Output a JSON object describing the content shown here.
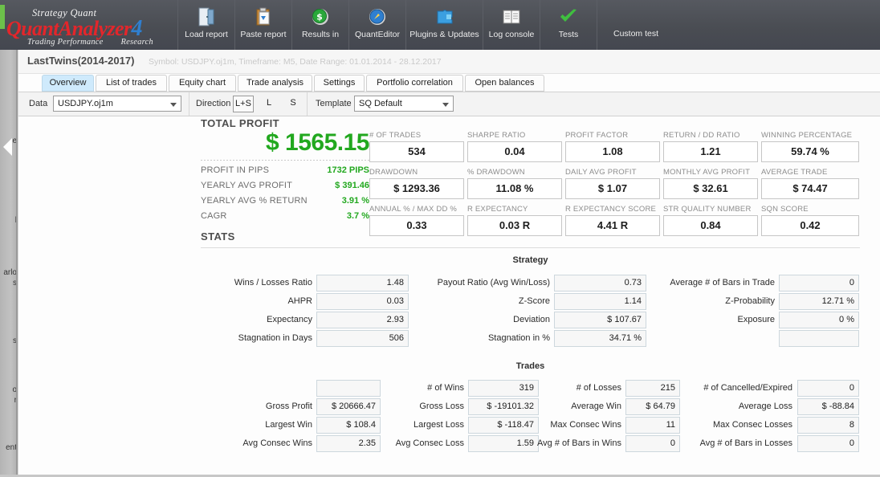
{
  "app": {
    "logo_top": "Strategy Quant",
    "logo_main": "QuantAnalyzer",
    "logo_version": "4",
    "logo_sub_1": "Trading Performance",
    "logo_sub_2": "Research"
  },
  "toolbar": {
    "buttons": [
      {
        "label": "Load report",
        "icon": "door-open-icon"
      },
      {
        "label": "Paste report",
        "icon": "clipboard-paste-icon"
      },
      {
        "label": "Results in",
        "icon": "dollar-coin-icon"
      },
      {
        "label": "QuantEditor",
        "icon": "globe-compass-icon"
      },
      {
        "label": "Plugins & Updates",
        "icon": "puzzle-piece-icon"
      },
      {
        "label": "Log console",
        "icon": "book-icon"
      },
      {
        "label": "Tests",
        "icon": "green-check-icon"
      },
      {
        "label": "Custom test",
        "icon": "none"
      }
    ]
  },
  "sidebar": {
    "fragments": [
      "e",
      "l",
      "arlo",
      "s",
      "s",
      "o",
      "r",
      "ent"
    ]
  },
  "header": {
    "title": "LastTwins(2014-2017)",
    "subtitle": "Symbol: USDJPY.oj1m, Timeframe: M5, Date Range: 01.01.2014 - 28.12.2017"
  },
  "tabs": [
    {
      "label": "Overview",
      "active": true
    },
    {
      "label": "List of trades",
      "active": false
    },
    {
      "label": "Equity chart",
      "active": false
    },
    {
      "label": "Trade analysis",
      "active": false
    },
    {
      "label": "Settings",
      "active": false
    },
    {
      "label": "Portfolio correlation",
      "active": false
    },
    {
      "label": "Open balances",
      "active": false
    }
  ],
  "filters": {
    "data_label": "Data",
    "data_value": "USDJPY.oj1m",
    "direction_label": "Direction",
    "direction_options": [
      "L+S",
      "L",
      "S"
    ],
    "direction_selected": "L+S",
    "template_label": "Template",
    "template_value": "SQ Default"
  },
  "total_profit": {
    "title": "TOTAL PROFIT",
    "value": "$ 1565.15",
    "rows": [
      {
        "key": "PROFIT IN PIPS",
        "value": "1732 PIPS"
      },
      {
        "key": "YEARLY AVG PROFIT",
        "value": "$ 391.46"
      },
      {
        "key": "YEARLY AVG % RETURN",
        "value": "3.91 %"
      },
      {
        "key": "CAGR",
        "value": "3.7 %"
      }
    ]
  },
  "kpis": [
    {
      "caption": "# OF TRADES",
      "value": "534"
    },
    {
      "caption": "SHARPE RATIO",
      "value": "0.04"
    },
    {
      "caption": "PROFIT FACTOR",
      "value": "1.08"
    },
    {
      "caption": "RETURN / DD RATIO",
      "value": "1.21"
    },
    {
      "caption": "WINNING PERCENTAGE",
      "value": "59.74 %"
    },
    {
      "caption": "DRAWDOWN",
      "value": "$ 1293.36"
    },
    {
      "caption": "% DRAWDOWN",
      "value": "11.08 %"
    },
    {
      "caption": "DAILY AVG PROFIT",
      "value": "$ 1.07"
    },
    {
      "caption": "MONTHLY AVG PROFIT",
      "value": "$ 32.61"
    },
    {
      "caption": "AVERAGE TRADE",
      "value": "$ 74.47"
    },
    {
      "caption": "ANNUAL % / MAX DD %",
      "value": "0.33"
    },
    {
      "caption": "R EXPECTANCY",
      "value": "0.03 R"
    },
    {
      "caption": "R EXPECTANCY SCORE",
      "value": "4.41 R"
    },
    {
      "caption": "STR QUALITY NUMBER",
      "value": "0.84"
    },
    {
      "caption": "SQN SCORE",
      "value": "0.42"
    }
  ],
  "stats": {
    "heading": "STATS",
    "strategy_title": "Strategy",
    "strategy_rows": [
      [
        {
          "label": "Wins / Losses Ratio",
          "value": "1.48"
        },
        {
          "label": "Payout Ratio (Avg Win/Loss)",
          "value": "0.73"
        },
        {
          "label": "Average # of Bars in Trade",
          "value": "0"
        }
      ],
      [
        {
          "label": "AHPR",
          "value": "0.03"
        },
        {
          "label": "Z-Score",
          "value": "1.14"
        },
        {
          "label": "Z-Probability",
          "value": "12.71 %"
        }
      ],
      [
        {
          "label": "Expectancy",
          "value": "2.93"
        },
        {
          "label": "Deviation",
          "value": "$ 107.67"
        },
        {
          "label": "Exposure",
          "value": "0 %"
        }
      ],
      [
        {
          "label": "Stagnation in Days",
          "value": "506"
        },
        {
          "label": "Stagnation in %",
          "value": "34.71 %"
        },
        {
          "label": "",
          "value": ""
        }
      ]
    ],
    "trades_title": "Trades",
    "trades_rows": [
      [
        {
          "label": "",
          "value": ""
        },
        {
          "label": "# of Wins",
          "value": "319"
        },
        {
          "label": "# of Losses",
          "value": "215"
        },
        {
          "label": "# of Cancelled/Expired",
          "value": "0"
        }
      ],
      [
        {
          "label": "Gross Profit",
          "value": "$ 20666.47"
        },
        {
          "label": "Gross Loss",
          "value": "$ -19101.32"
        },
        {
          "label": "Average Win",
          "value": "$ 64.79"
        },
        {
          "label": "Average Loss",
          "value": "$ -88.84"
        }
      ],
      [
        {
          "label": "Largest Win",
          "value": "$ 108.4"
        },
        {
          "label": "Largest Loss",
          "value": "$ -118.47"
        },
        {
          "label": "Max Consec Wins",
          "value": "11"
        },
        {
          "label": "Max Consec Losses",
          "value": "8"
        }
      ],
      [
        {
          "label": "Avg Consec Wins",
          "value": "2.35"
        },
        {
          "label": "Avg Consec Loss",
          "value": "1.59"
        },
        {
          "label": "Avg # of Bars in Wins",
          "value": "0"
        },
        {
          "label": "Avg # of Bars in Losses",
          "value": "0"
        }
      ]
    ]
  },
  "colors": {
    "profit_green": "#22a81f",
    "brand_red": "#e3262b",
    "brand_blue": "#2f7fd0",
    "toolbar_bg": "#4c4f55",
    "tab_active": "#cfeafc"
  }
}
